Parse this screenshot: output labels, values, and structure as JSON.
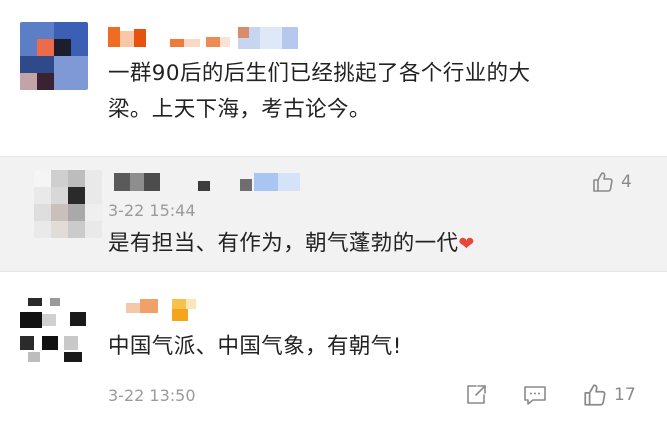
{
  "comments": [
    {
      "text_line1": "一群90后的后生们已经挑起了各个行业的大",
      "text_line2": "梁。上天下海，考古论今。"
    },
    {
      "timestamp": "3-22 15:44",
      "text": "是有担当、有作为，朝气蓬勃的一代",
      "emoji": "❤",
      "like_count": "4"
    },
    {
      "text": "中国气派、中国气象，有朝气!",
      "timestamp": "3-22 13:50",
      "like_count": "17"
    }
  ],
  "icons": {
    "like": "thumbs-up-icon",
    "share": "share-icon",
    "reply": "comment-icon",
    "heart": "heart-emoji"
  },
  "colors": {
    "text": "#222222",
    "meta": "#9a9a9a",
    "highlight_bg": "#f2f2f2",
    "heart": "#e8463a"
  }
}
